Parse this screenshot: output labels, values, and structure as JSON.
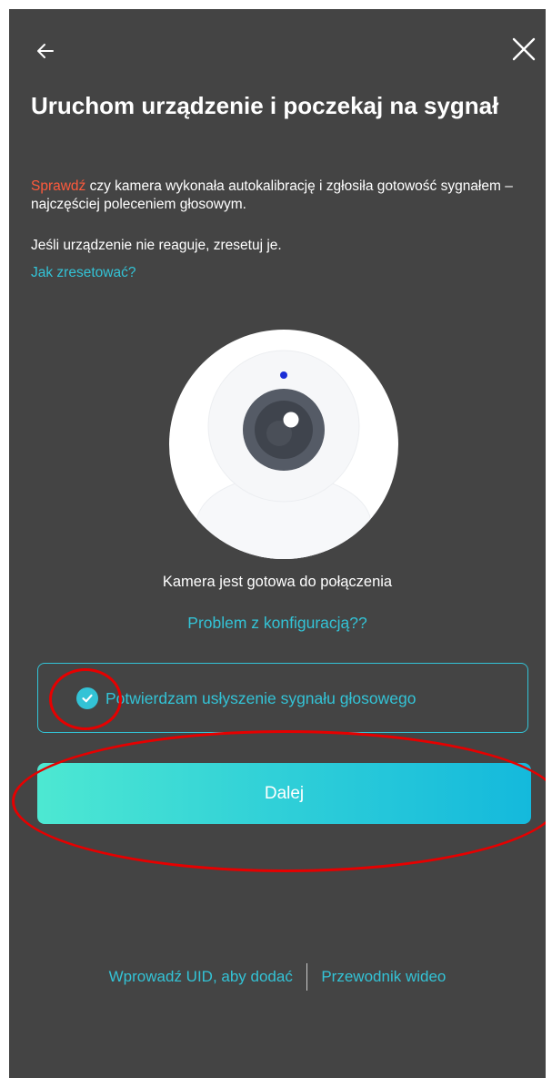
{
  "header": {
    "back_icon": "arrow-left-icon",
    "close_icon": "close-icon"
  },
  "title": "Uruchom urządzenie i poczekaj na sygnał",
  "description": {
    "accent": "Sprawdź",
    "rest": " czy kamera wykonała autokalibrację i zgłosiła gotowość sygnałem – najczęściej poleceniem głosowym."
  },
  "note": "Jeśli urządzenie nie reaguje, zresetuj je.",
  "reset_link": "Jak zresetować?",
  "illustration": {
    "icon": "webcam-icon"
  },
  "status": "Kamera jest gotowa do połączenia",
  "problem_link": "Problem z konfiguracją??",
  "confirm": {
    "checked": true,
    "label": "Potwierdzam usłyszenie sygnału głosowego"
  },
  "next_button": "Dalej",
  "footer": {
    "uid_link": "Wprowadź UID, aby dodać",
    "video_link": "Przewodnik wideo"
  },
  "colors": {
    "background": "#444444",
    "accent_cyan": "#33c3d6",
    "accent_red": "#ff5a3c",
    "annotation_red": "#e60000"
  }
}
